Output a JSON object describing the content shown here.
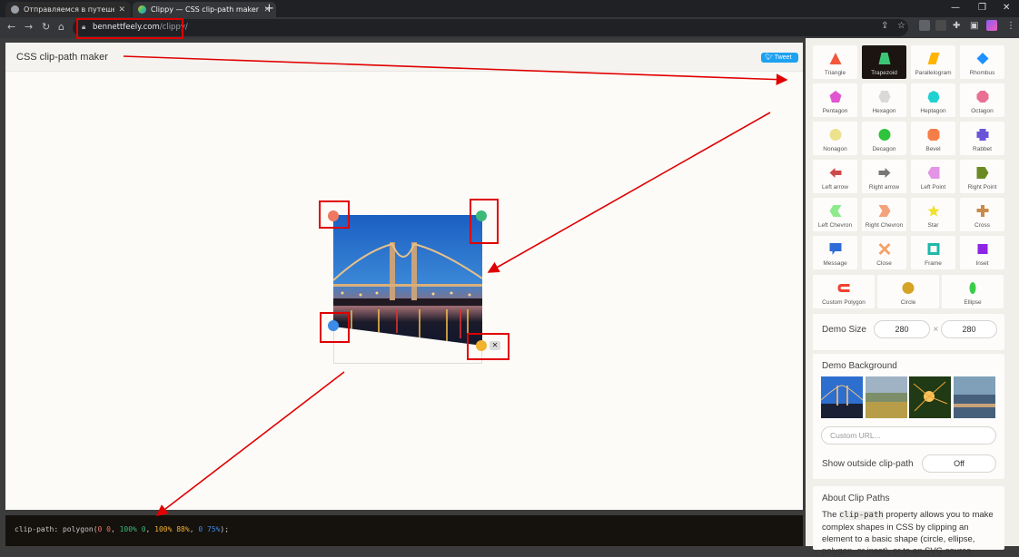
{
  "browser": {
    "tabs": [
      {
        "title": "Отправляемся в путешествие!",
        "active": false
      },
      {
        "title": "Clippy — CSS clip-path maker",
        "active": true
      }
    ],
    "url_host": "bennettfeely.com",
    "url_path": "/clippy/"
  },
  "page": {
    "title": "CSS clip-path maker",
    "tweet_label": "Tweet"
  },
  "shapes": [
    {
      "label": "Triangle",
      "color": "#f3573b"
    },
    {
      "label": "Trapezoid",
      "color": "#3cc477",
      "active": true
    },
    {
      "label": "Parallelogram",
      "color": "#ffb400"
    },
    {
      "label": "Rhombus",
      "color": "#1e90ff"
    },
    {
      "label": "Pentagon",
      "color": "#e055d0"
    },
    {
      "label": "Hexagon",
      "color": "#d9d9d9"
    },
    {
      "label": "Heptagon",
      "color": "#1fd1d1"
    },
    {
      "label": "Octagon",
      "color": "#ea6f92"
    },
    {
      "label": "Nonagon",
      "color": "#ece28e"
    },
    {
      "label": "Decagon",
      "color": "#2ec43c"
    },
    {
      "label": "Bevel",
      "color": "#f57e48"
    },
    {
      "label": "Rabbet",
      "color": "#6a55d9"
    },
    {
      "label": "Left arrow",
      "color": "#cd4a4a"
    },
    {
      "label": "Right arrow",
      "color": "#777777"
    },
    {
      "label": "Left Point",
      "color": "#e494e4"
    },
    {
      "label": "Right Point",
      "color": "#6c8a22"
    },
    {
      "label": "Left Chevron",
      "color": "#8dea8d"
    },
    {
      "label": "Right Chevron",
      "color": "#f3a27b"
    },
    {
      "label": "Star",
      "color": "#f2e12c"
    },
    {
      "label": "Cross",
      "color": "#c98a4a"
    },
    {
      "label": "Message",
      "color": "#2f6dd6"
    },
    {
      "label": "Close",
      "color": "#f3a26a"
    },
    {
      "label": "Frame",
      "color": "#1fb8aa"
    },
    {
      "label": "Inset",
      "color": "#8e24e6"
    },
    {
      "label": "Custom Polygon",
      "color": "#ee4330"
    },
    {
      "label": "Circle",
      "color": "#d6a324"
    },
    {
      "label": "Ellipse",
      "color": "#3dcc4a"
    }
  ],
  "demo_size": {
    "label": "Demo Size",
    "width": "280",
    "height": "280",
    "separator": "×"
  },
  "demo_background": {
    "label": "Demo Background",
    "custom_url_placeholder": "Custom URL..."
  },
  "show_outside": {
    "label": "Show outside clip-path",
    "value": "Off"
  },
  "about": {
    "title": "About Clip Paths",
    "text_before": "The ",
    "code": "clip-path",
    "text_after": " property allows you to make complex shapes in CSS by clipping an element to a basic shape (circle, ellipse, polygon, or inset), or to an SVG source."
  },
  "code_bar": {
    "prop": "clip-path: polygon(",
    "p1": "0 0",
    "p2": "100% 0",
    "p3": "100% 88%",
    "p4": "0 75%",
    "end": ");"
  },
  "handles": [
    {
      "name": "handle-top-left",
      "color": "#ef7860"
    },
    {
      "name": "handle-top-right",
      "color": "#3cb879"
    },
    {
      "name": "handle-bottom-left",
      "color": "#3d8be8"
    },
    {
      "name": "handle-bottom-right",
      "color": "#f2b230"
    }
  ],
  "delete_point_symbol": "✕"
}
